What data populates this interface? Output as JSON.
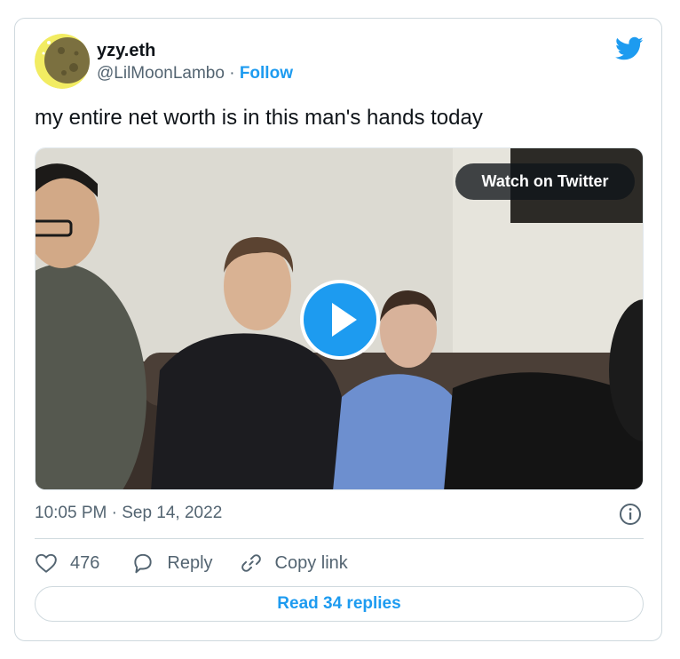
{
  "author": {
    "name": "yzy.eth",
    "handle": "@LilMoonLambo",
    "separator": "·",
    "follow_label": "Follow",
    "avatar_icon": "moon-avatar-icon"
  },
  "brand_icon": "twitter-bird-icon",
  "tweet": {
    "text": "my entire net worth is in this man's hands today"
  },
  "media": {
    "type": "video",
    "watch_label": "Watch on Twitter",
    "play_icon": "play-icon"
  },
  "meta": {
    "timestamp": "10:05 PM · Sep 14, 2022",
    "info_icon": "info-icon"
  },
  "actions": {
    "like_count": "476",
    "reply_label": "Reply",
    "copy_label": "Copy link"
  },
  "read_replies_label": "Read 34 replies",
  "colors": {
    "accent": "#1d9bf0",
    "text_primary": "#0f1419",
    "text_secondary": "#536471",
    "border": "#cfd9de"
  }
}
